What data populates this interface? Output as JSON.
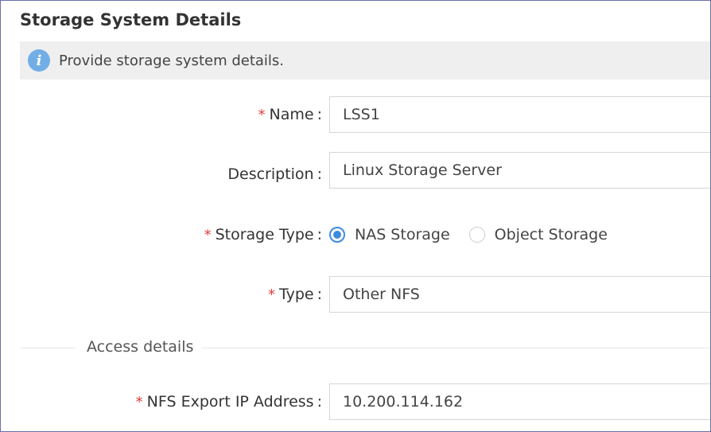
{
  "page": {
    "title": "Storage System Details"
  },
  "info": {
    "icon": "info-icon",
    "text": "Provide storage system details.",
    "icon_glyph": "i"
  },
  "form": {
    "name": {
      "label": "Name",
      "value": "LSS1",
      "required": true
    },
    "description": {
      "label": "Description",
      "value": "Linux Storage Server",
      "required": false
    },
    "storage_type": {
      "label": "Storage Type",
      "required": true,
      "options": [
        {
          "label": "NAS Storage",
          "selected": true
        },
        {
          "label": "Object Storage",
          "selected": false
        }
      ]
    },
    "type": {
      "label": "Type",
      "value": "Other NFS",
      "required": true
    },
    "section_access": "Access details",
    "nfs_ip": {
      "label": "NFS Export IP Address",
      "value": "10.200.114.162",
      "required": true
    }
  },
  "symbols": {
    "required_mark": "*",
    "colon": ":"
  },
  "colors": {
    "required": "#e03c3c",
    "accent": "#3c8be0",
    "info_icon": "#72aee6",
    "banner_bg": "#efefef"
  }
}
